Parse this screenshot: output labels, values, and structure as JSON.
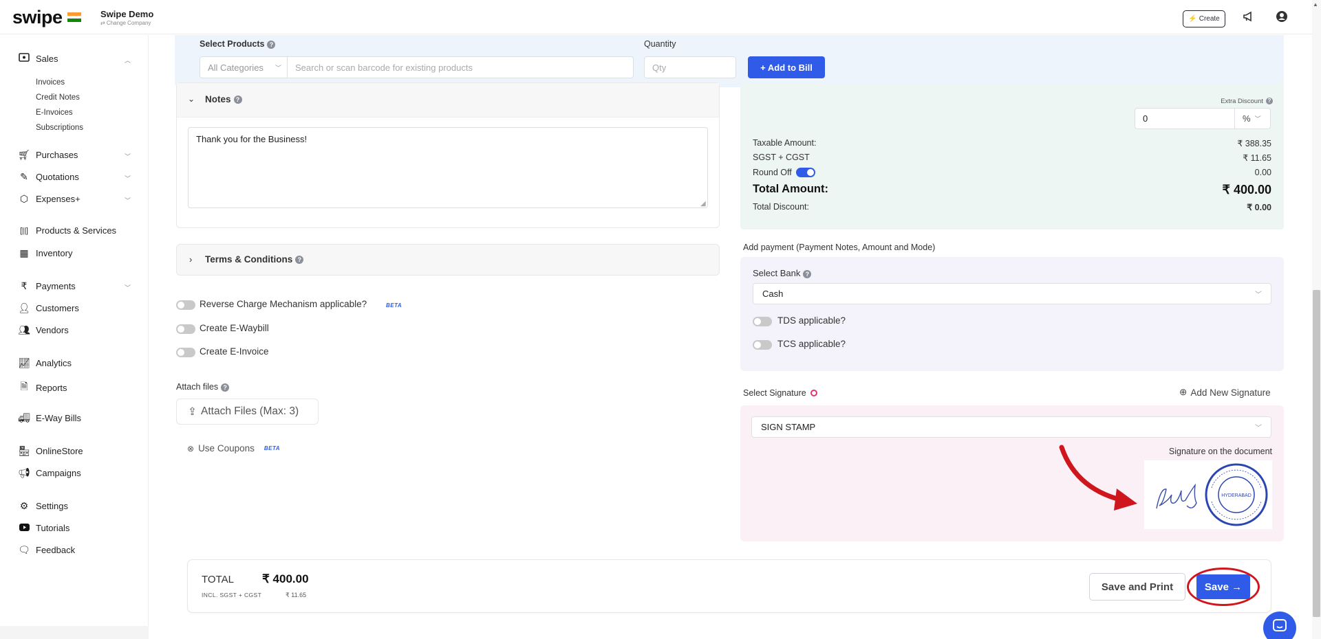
{
  "header": {
    "logo": "swipe",
    "company_name": "Swipe Demo",
    "change_company": "⇄ Change Company",
    "create_label": "Create",
    "flag_colors": [
      "#ff9933",
      "#ffffff",
      "#138808"
    ]
  },
  "sidebar": {
    "sales": "Sales",
    "sales_sub": [
      "Invoices",
      "Credit Notes",
      "E-Invoices",
      "Subscriptions"
    ],
    "purchases": "Purchases",
    "quotations": "Quotations",
    "expenses": "Expenses+",
    "products": "Products & Services",
    "inventory": "Inventory",
    "payments": "Payments",
    "customers": "Customers",
    "vendors": "Vendors",
    "analytics": "Analytics",
    "reports": "Reports",
    "eway": "E-Way Bills",
    "onlinestore": "OnlineStore",
    "campaigns": "Campaigns",
    "settings": "Settings",
    "tutorials": "Tutorials",
    "feedback": "Feedback"
  },
  "products": {
    "label": "Select Products",
    "quantity_label": "Quantity",
    "category": "All Categories",
    "search_placeholder": "Search or scan barcode for existing products",
    "qty_placeholder": "Qty",
    "add_button": "+ Add to Bill"
  },
  "notes": {
    "label": "Notes",
    "value": "Thank you for the Business!"
  },
  "terms": {
    "label": "Terms & Conditions"
  },
  "options": {
    "reverse_charge": "Reverse Charge Mechanism applicable?",
    "beta": "BETA",
    "ewaybill": "Create E-Waybill",
    "einvoice": "Create E-Invoice",
    "attach_label": "Attach files",
    "attach_button": "Attach Files (Max: 3)",
    "coupons": "Use Coupons"
  },
  "summary": {
    "extra_discount_label": "Extra Discount",
    "extra_discount_value": "0",
    "discount_unit": "%",
    "taxable_label": "Taxable Amount:",
    "taxable_value": "₹ 388.35",
    "tax_label": "SGST + CGST",
    "tax_value": "₹ 11.65",
    "roundoff_label": "Round Off",
    "roundoff_value": "0.00",
    "total_label": "Total Amount:",
    "total_value": "₹ 400.00",
    "discount_label": "Total Discount:",
    "discount_value": "₹ 0.00"
  },
  "payment": {
    "title": "Add payment (Payment Notes, Amount and Mode)",
    "bank_label": "Select Bank",
    "bank_value": "Cash",
    "tds": "TDS applicable?",
    "tcs": "TCS applicable?"
  },
  "signature": {
    "label": "Select Signature",
    "add_new": "Add New Signature",
    "value": "SIGN STAMP",
    "on_document": "Signature on the document",
    "stamp_text": "HYDERABAD"
  },
  "footer": {
    "total_label": "TOTAL",
    "total_value": "₹ 400.00",
    "incl_label": "INCL. SGST + CGST",
    "incl_value": "₹ 11.65",
    "save_print": "Save and Print",
    "save": "Save →"
  },
  "colors": {
    "primary": "#2f5be8",
    "annotation": "#d0161d"
  }
}
